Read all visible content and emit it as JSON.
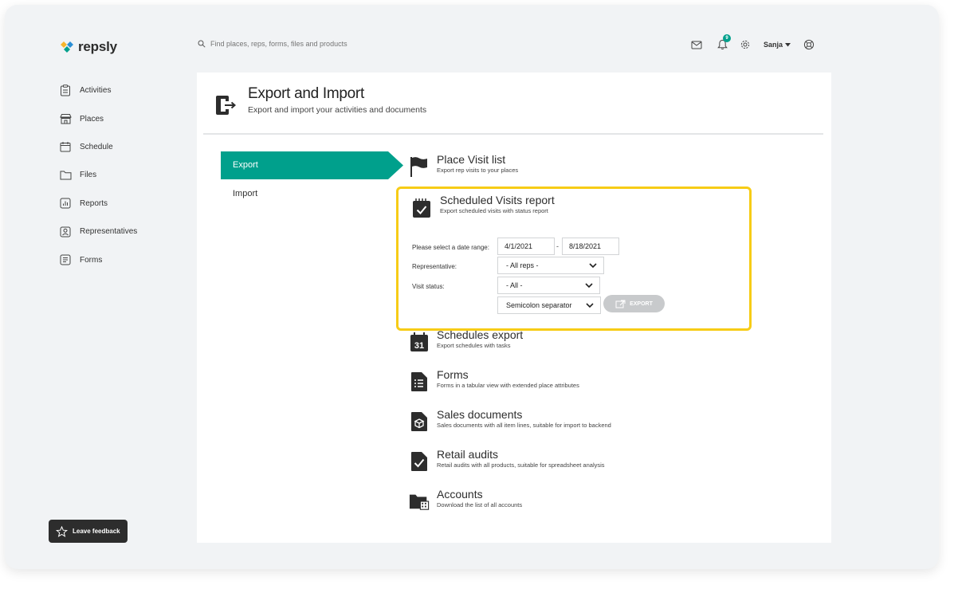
{
  "app": {
    "logo_text": "repsly"
  },
  "search": {
    "placeholder": "Find places, reps, forms, files and products"
  },
  "header": {
    "notification_count": "9",
    "user_name": "Sanja"
  },
  "sidebar": {
    "items": [
      {
        "label": "Activities",
        "icon": "clipboard-icon"
      },
      {
        "label": "Places",
        "icon": "store-icon"
      },
      {
        "label": "Schedule",
        "icon": "calendar-icon"
      },
      {
        "label": "Files",
        "icon": "folder-icon"
      },
      {
        "label": "Reports",
        "icon": "chart-icon"
      },
      {
        "label": "Representatives",
        "icon": "person-icon"
      },
      {
        "label": "Forms",
        "icon": "form-icon"
      }
    ],
    "feedback_label": "Leave feedback"
  },
  "page": {
    "title": "Export and Import",
    "subtitle": "Export and import your activities and documents"
  },
  "tabs": {
    "export": "Export",
    "import": "Import"
  },
  "export_items": [
    {
      "title": "Place Visit list",
      "subtitle": "Export rep visits to your places",
      "icon": "flag-icon"
    },
    {
      "title": "Schedules export",
      "subtitle": "Export schedules with tasks",
      "icon": "calendar-31-icon"
    },
    {
      "title": "Forms",
      "subtitle": "Forms in a tabular view with extended place attributes",
      "icon": "form-doc-icon"
    },
    {
      "title": "Sales documents",
      "subtitle": "Sales documents with all item lines, suitable for import to backend",
      "icon": "box-doc-icon"
    },
    {
      "title": "Retail audits",
      "subtitle": "Retail audits with all products, suitable for spreadsheet analysis",
      "icon": "check-doc-icon"
    },
    {
      "title": "Accounts",
      "subtitle": "Download the list of all accounts",
      "icon": "folder-building-icon"
    }
  ],
  "scheduled_report": {
    "title": "Scheduled Visits report",
    "subtitle": "Export scheduled visits with status report",
    "date_label": "Please select a date range:",
    "date_from": "4/1/2021",
    "date_to": "8/18/2021",
    "rep_label": "Representative:",
    "rep_value": "- All reps -",
    "status_label": "Visit status:",
    "status_value": "- All -",
    "separator_value": "Semicolon separator",
    "export_label": "EXPORT"
  },
  "colors": {
    "accent": "#00a08c",
    "highlight": "#f7cc16",
    "dark": "#2d2d2d"
  }
}
